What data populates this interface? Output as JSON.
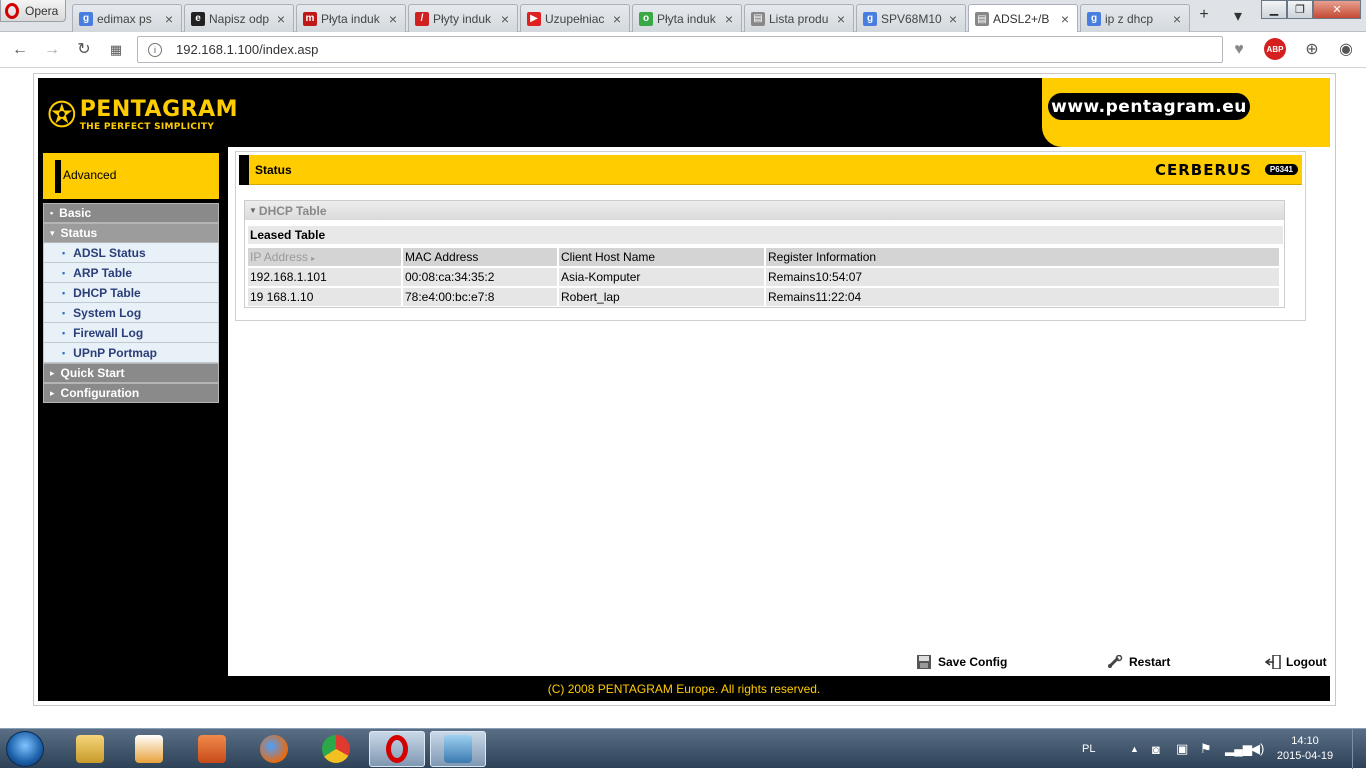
{
  "browser": {
    "opera_label": "Opera",
    "tabs": [
      {
        "title": "edimax ps",
        "fav": "g",
        "color": "#4a7de0"
      },
      {
        "title": "Napisz odp",
        "fav": "e",
        "color": "#222222"
      },
      {
        "title": "Płyta induk",
        "fav": "m",
        "color": "#c01818"
      },
      {
        "title": "Płyty induk",
        "fav": "/",
        "color": "#d02020"
      },
      {
        "title": "Uzupełniac",
        "fav": "▶",
        "color": "#e02020"
      },
      {
        "title": "Płyta induk",
        "fav": "o",
        "color": "#39a845"
      },
      {
        "title": "Lista produ",
        "fav": "▤",
        "color": "#888888"
      },
      {
        "title": "SPV68M10",
        "fav": "g",
        "color": "#4a7de0"
      },
      {
        "title": "ADSL2+/B",
        "fav": "▤",
        "color": "#888888"
      },
      {
        "title": "ip z dhcp",
        "fav": "g",
        "color": "#4a7de0"
      }
    ],
    "url": "192.168.1.100/index.asp",
    "abp": "ABP"
  },
  "header": {
    "brand_name": "PENTAGRAM",
    "brand_slogan": "THE PERFECT SIMPLICITY",
    "site_url": "www.pentagram.eu"
  },
  "sidebar": {
    "section": "Advanced",
    "items": [
      {
        "label": "Basic",
        "level": "top",
        "open": false
      },
      {
        "label": "Status",
        "level": "top",
        "open": true
      },
      {
        "label": "ADSL Status",
        "level": "sub"
      },
      {
        "label": "ARP Table",
        "level": "sub"
      },
      {
        "label": "DHCP Table",
        "level": "sub"
      },
      {
        "label": "System Log",
        "level": "sub"
      },
      {
        "label": "Firewall Log",
        "level": "sub"
      },
      {
        "label": "UPnP Portmap",
        "level": "sub"
      },
      {
        "label": "Quick Start",
        "level": "top",
        "open": false
      },
      {
        "label": "Configuration",
        "level": "top",
        "open": false
      }
    ]
  },
  "content": {
    "title": "Status",
    "product": "CERBERUS",
    "model": "P6341",
    "panel_title": "DHCP Table",
    "table_title": "Leased Table",
    "columns": [
      "IP Address",
      "MAC Address",
      "Client Host Name",
      "Register Information"
    ],
    "rows": [
      [
        "192.168.1.101",
        "00:08:ca:34:35:2",
        "Asia-Komputer",
        "Remains10:54:07"
      ],
      [
        "19  168.1.10",
        "78:e4:00:bc:e7:8",
        "Robert_lap",
        "Remains11:22:04"
      ]
    ]
  },
  "footer": {
    "save": "Save Config",
    "restart": "Restart",
    "logout": "Logout",
    "copyright": "(C) 2008 PENTAGRAM Europe. All rights reserved."
  },
  "taskbar": {
    "lang": "PL",
    "time": "14:10",
    "date": "2015-04-19"
  }
}
